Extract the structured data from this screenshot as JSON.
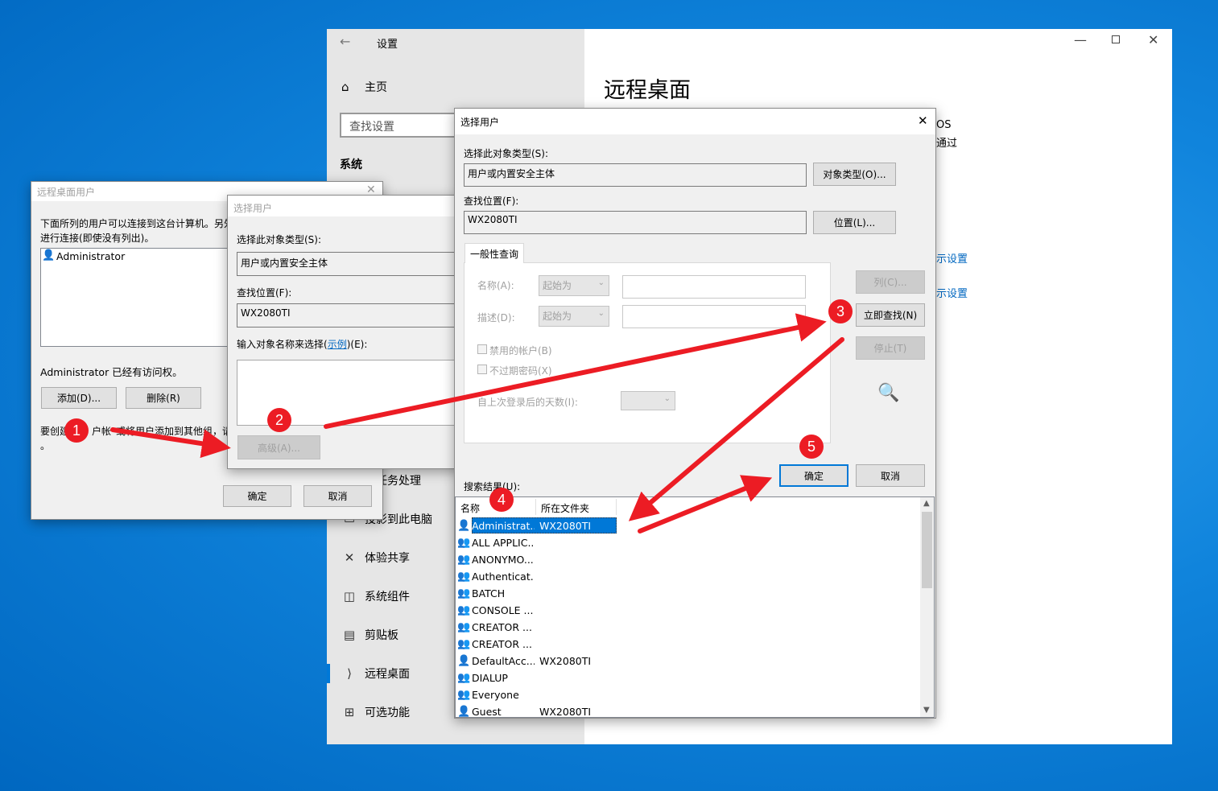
{
  "settings": {
    "title": "设置",
    "home": "主页",
    "search_placeholder": "查找设置",
    "section": "系统",
    "page_title": "远程桌面",
    "right_text_1": "OS",
    "right_text_2": "通过",
    "right_link_1": "示设置",
    "right_link_2": "示设置",
    "nav": [
      {
        "label": "多任务处理",
        "icon": "multitask-icon"
      },
      {
        "label": "投影到此电脑",
        "icon": "project-icon"
      },
      {
        "label": "体验共享",
        "icon": "share-experience-icon"
      },
      {
        "label": "系统组件",
        "icon": "system-components-icon"
      },
      {
        "label": "剪贴板",
        "icon": "clipboard-icon"
      },
      {
        "label": "远程桌面",
        "icon": "remote-desktop-icon"
      },
      {
        "label": "可选功能",
        "icon": "optional-features-icon"
      }
    ]
  },
  "rdusers": {
    "title": "远程桌面用户",
    "desc_1": "下面所列的用户可以连接到这台计算机。另外",
    "desc_2": "进行连接(即使没有列出)。",
    "list_item": "Administrator",
    "access_text": "Administrator 已经有访问权。",
    "add_button": "添加(D)...",
    "remove_button": "删除(R)",
    "footer_1": "要创建",
    "footer_2": "户帐",
    "footer_3": "或将用户添加到其他组，请",
    "footer_4": "。",
    "ok": "确定",
    "cancel": "取消"
  },
  "select_small": {
    "title": "选择用户",
    "obj_type_label": "选择此对象类型(S):",
    "obj_type_value": "用户或内置安全主体",
    "location_label": "查找位置(F):",
    "location_value": "WX2080TI",
    "enter_label_pre": "输入对象名称来选择(",
    "enter_label_link": "示例",
    "enter_label_post": ")(E):",
    "advanced_button": "高级(A)..."
  },
  "select_adv": {
    "title": "选择用户",
    "obj_type_label": "选择此对象类型(S):",
    "obj_type_value": "用户或内置安全主体",
    "obj_type_button": "对象类型(O)...",
    "location_label": "查找位置(F):",
    "location_value": "WX2080TI",
    "location_button": "位置(L)...",
    "tab": "一般性查询",
    "name_label": "名称(A):",
    "desc_label": "描述(D):",
    "starts_with": "起始为",
    "disabled_accounts": "禁用的帐户(B)",
    "non_expiring": "不过期密码(X)",
    "days_label": "自上次登录后的天数(I):",
    "columns_button": "列(C)...",
    "find_now_button": "立即查找(N)",
    "stop_button": "停止(T)",
    "ok": "确定",
    "cancel": "取消",
    "results_label": "搜索结果(U):",
    "col_name": "名称",
    "col_folder": "所在文件夹",
    "results": [
      {
        "name": "Administrat...",
        "folder": "WX2080TI"
      },
      {
        "name": "ALL APPLIC...",
        "folder": ""
      },
      {
        "name": "ANONYMO...",
        "folder": ""
      },
      {
        "name": "Authenticat...",
        "folder": ""
      },
      {
        "name": "BATCH",
        "folder": ""
      },
      {
        "name": "CONSOLE ...",
        "folder": ""
      },
      {
        "name": "CREATOR ...",
        "folder": ""
      },
      {
        "name": "CREATOR ...",
        "folder": ""
      },
      {
        "name": "DefaultAcc...",
        "folder": "WX2080TI"
      },
      {
        "name": "DIALUP",
        "folder": ""
      },
      {
        "name": "Everyone",
        "folder": ""
      },
      {
        "name": "Guest",
        "folder": "WX2080TI"
      }
    ]
  },
  "markers": [
    "1",
    "2",
    "3",
    "4",
    "5"
  ],
  "colors": {
    "accent": "#0078d7",
    "marker": "#ec1c24",
    "link": "#0067c0"
  }
}
